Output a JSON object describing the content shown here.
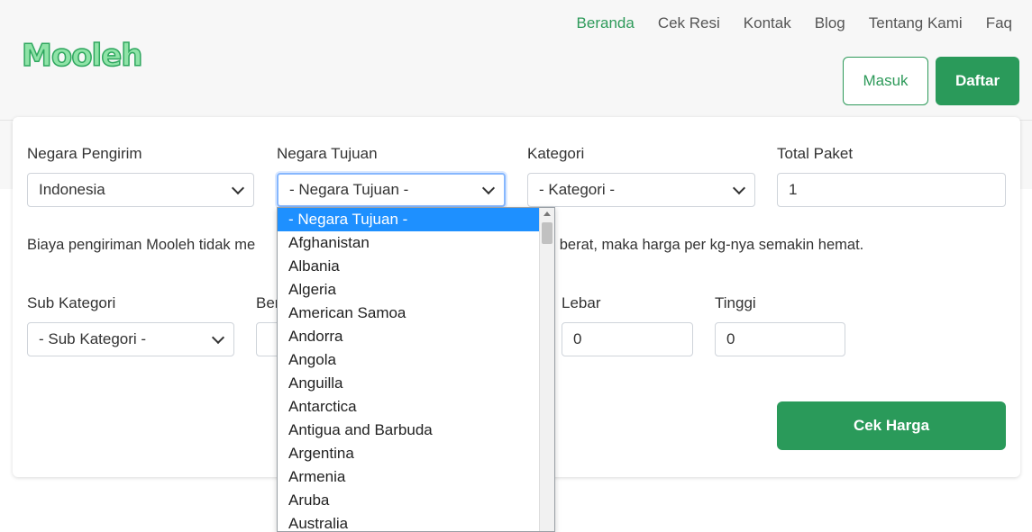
{
  "brand": {
    "logo_text": "Mooleh"
  },
  "nav": {
    "items": [
      "Beranda",
      "Cek Resi",
      "Kontak",
      "Blog",
      "Tentang Kami",
      "Faq"
    ],
    "active": "Beranda"
  },
  "auth": {
    "login": "Masuk",
    "register": "Daftar"
  },
  "form": {
    "sender_country": {
      "label": "Negara Pengirim",
      "value": "Indonesia"
    },
    "destination_country": {
      "label": "Negara Tujuan",
      "value": "- Negara Tujuan -"
    },
    "category": {
      "label": "Kategori",
      "value": "- Kategori -"
    },
    "total_packages": {
      "label": "Total Paket",
      "value": "1"
    },
    "info_text_left": "Biaya pengiriman Mooleh tidak me",
    "info_text_right": "makin berat, maka harga per kg-nya semakin hemat.",
    "sub_category": {
      "label": "Sub Kategori",
      "value": "- Sub Kategori -"
    },
    "weight": {
      "label": "Ber",
      "value": ""
    },
    "width": {
      "label": "Lebar",
      "value": "0"
    },
    "height": {
      "label": "Tinggi",
      "value": "0"
    },
    "submit": "Cek Harga"
  },
  "dropdown": {
    "options": [
      "- Negara Tujuan -",
      "Afghanistan",
      "Albania",
      "Algeria",
      "American Samoa",
      "Andorra",
      "Angola",
      "Anguilla",
      "Antarctica",
      "Antigua and Barbuda",
      "Argentina",
      "Armenia",
      "Aruba",
      "Australia"
    ],
    "selected_index": 0
  },
  "colors": {
    "accent": "#2a9a5a",
    "selected_option": "#1e90ff",
    "focus_border": "#86b7fe"
  }
}
